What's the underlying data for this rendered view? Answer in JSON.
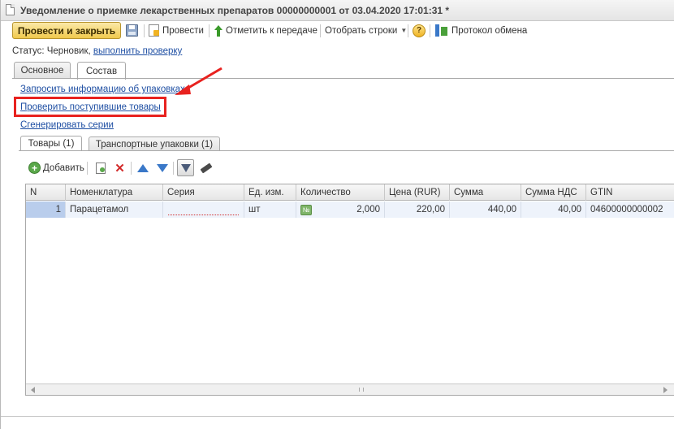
{
  "window": {
    "title": "Уведомление о приемке лекарственных препаратов 00000000001 от 03.04.2020 17:01:31 *"
  },
  "toolbar": {
    "post_and_close": "Провести и закрыть",
    "post": "Провести",
    "mark_for_transfer": "Отметить к передаче",
    "select_rows": "Отобрать строки",
    "help": "?",
    "exchange_protocol": "Протокол обмена"
  },
  "status": {
    "prefix": "Статус: Черновик,",
    "action_link": "выполнить проверку"
  },
  "tabs": [
    "Основное",
    "Состав"
  ],
  "actions": {
    "request_packaging_info": "Запросить информацию об упаковках",
    "check_received_goods": "Проверить поступившие товары",
    "generate_series": "Сгенерировать серии"
  },
  "subtabs": [
    "Товары (1)",
    "Транспортные упаковки (1)"
  ],
  "grid_toolbar": {
    "add": "Добавить"
  },
  "table": {
    "columns": [
      "N",
      "Номенклатура",
      "Серия",
      "Ед. изм.",
      "Количество",
      "Цена (RUR)",
      "Сумма",
      "Сумма НДС",
      "GTIN"
    ],
    "rows": [
      {
        "n": "1",
        "nomenclature": "Парацетамол",
        "series": "",
        "unit": "шт",
        "qty_icon": "№",
        "quantity": "2,000",
        "price": "220,00",
        "sum": "440,00",
        "vat": "40,00",
        "gtin": "04600000000002"
      }
    ]
  },
  "colors": {
    "accent_button": "#f0c94d",
    "link": "#1f4fa3",
    "annotation": "#e8221f",
    "selected_row": "#eef3fb"
  }
}
